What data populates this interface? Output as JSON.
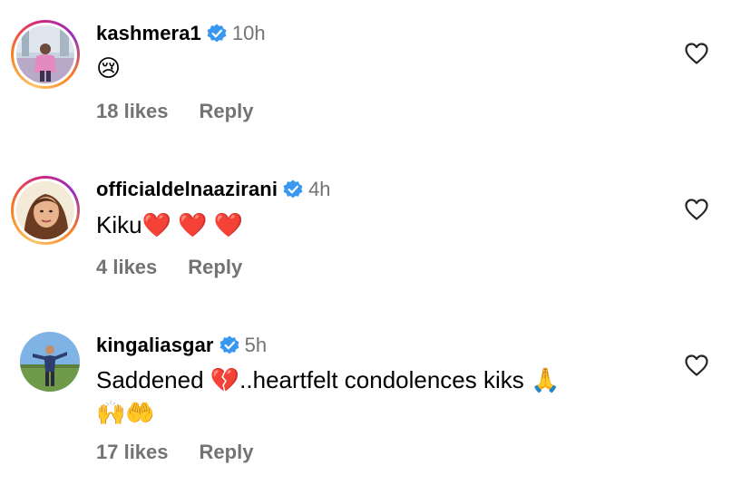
{
  "comments": [
    {
      "username": "kashmera1",
      "time": "10h",
      "text": "",
      "emoji": "😢",
      "likes": "18 likes",
      "reply": "Reply"
    },
    {
      "username": "officialdelnaazirani",
      "time": "4h",
      "text": "Kiku",
      "emoji": "❤️ ❤️ ❤️",
      "likes": "4 likes",
      "reply": "Reply"
    },
    {
      "username": "kingaliasgar",
      "time": "5h",
      "text": "Saddened 💔..heartfelt condolences kiks 🙏",
      "text_line2": "🙌🤲",
      "likes": "17 likes",
      "reply": "Reply"
    }
  ],
  "icons": {
    "verified": "verified-badge-icon",
    "like": "heart-outline-icon"
  },
  "colors": {
    "verified_blue": "#3897f0",
    "meta_gray": "#737373"
  }
}
